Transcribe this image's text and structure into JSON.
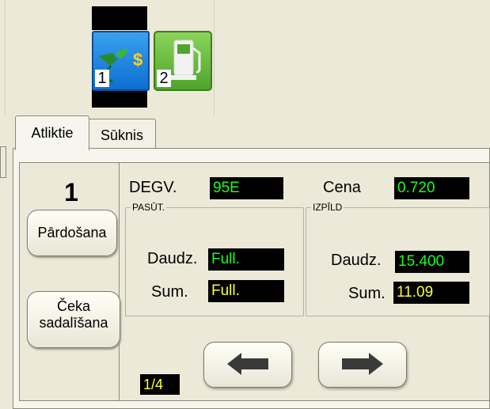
{
  "pumps": [
    {
      "number": "1",
      "icon": "fuel-nozzle-dollar-icon",
      "color": "#1a86e0"
    },
    {
      "number": "2",
      "icon": "fuel-pump-icon",
      "color": "#6cc040"
    }
  ],
  "tabs": [
    {
      "label": "Atliktie",
      "active": true
    },
    {
      "label": "Sūknis",
      "active": false
    }
  ],
  "pump_panel": {
    "selected_pump": "1",
    "buttons": {
      "sale": "Pārdošana",
      "split_line1": "Čeka",
      "split_line2": "sadalīšana"
    },
    "fuel_label": "DEGV.",
    "fuel_value": "95E",
    "price_label": "Cena",
    "price_value": "0.720",
    "order_group": {
      "title": "PASŪT.",
      "qty_label": "Daudz.",
      "qty_value": "Full.",
      "sum_label": "Sum.",
      "sum_value": "Full."
    },
    "exec_group": {
      "title": "IZPĪLD",
      "qty_label": "Daudz.",
      "qty_value": "15.400",
      "sum_label": "Sum.",
      "sum_value": "11.09"
    },
    "page_indicator": "1/4",
    "prev_icon": "arrow-left-icon",
    "next_icon": "arrow-right-icon"
  },
  "colors": {
    "lcd_green": "#19ff19",
    "lcd_yellow": "#ffff33",
    "background": "#ece9d8"
  }
}
